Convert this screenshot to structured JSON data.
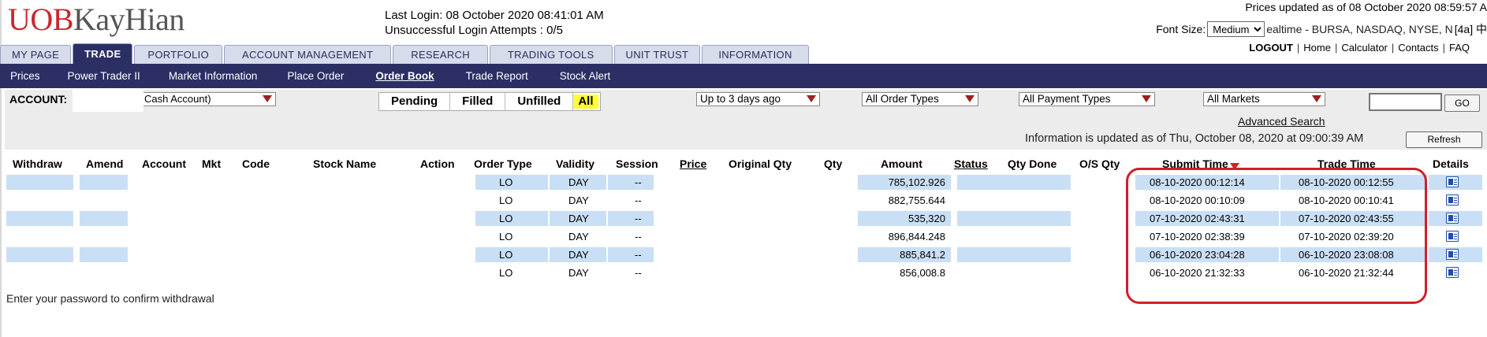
{
  "header": {
    "logo": {
      "part1": "UOB",
      "part2": "KayHian"
    },
    "last_login": "Last Login: 08 October 2020 08:41:01 AM",
    "unsuccessful_attempts": "Unsuccessful Login Attempts : 0/5",
    "prices_updated": "Prices updated as of 08 October 2020 08:59:57 A",
    "font_size_label": "Font Size:",
    "font_size_value": "Medium",
    "realtime_text": "ealtime - BURSA, NASDAQ, NYSE, N",
    "realtime_suffix": "[4a] 中",
    "links": {
      "logout": "LOGOUT",
      "home": "Home",
      "calculator": "Calculator",
      "contacts": "Contacts",
      "faq": "FAQ",
      "sep": "|"
    }
  },
  "tabs": [
    "MY PAGE",
    "TRADE",
    "PORTFOLIO",
    "ACCOUNT MANAGEMENT",
    "RESEARCH",
    "TRADING TOOLS",
    "UNIT TRUST",
    "INFORMATION"
  ],
  "subnav": [
    "Prices",
    "Power Trader II",
    "Market Information",
    "Place Order",
    "Order Book",
    "Trade Report",
    "Stock Alert"
  ],
  "filters": {
    "account_label": "ACCOUNT:",
    "account_value": "Cash Account)",
    "status_tabs": [
      "Pending",
      "Filled",
      "Unfilled",
      "All"
    ],
    "date_range": "Up to 3 days ago",
    "order_types": "All Order Types",
    "payment_types": "All Payment Types",
    "markets": "All Markets",
    "search_value": "",
    "go_label": "GO",
    "advanced_search": "Advanced Search",
    "info_updated": "Information is updated as of Thu, October 08, 2020 at 09:00:39 AM",
    "refresh_label": "Refresh"
  },
  "table": {
    "headers": {
      "withdraw": "Withdraw",
      "amend": "Amend",
      "account": "Account",
      "mkt": "Mkt",
      "code": "Code",
      "stock_name": "Stock Name",
      "action": "Action",
      "order_type": "Order Type",
      "validity": "Validity",
      "session": "Session",
      "price": "Price",
      "original_qty": "Original Qty",
      "qty": "Qty",
      "amount": "Amount",
      "status": "Status",
      "qty_done": "Qty Done",
      "os_qty": "O/S Qty",
      "submit_time": "Submit Time",
      "trade_time": "Trade Time",
      "details": "Details"
    },
    "rows": [
      {
        "order_type": "LO",
        "validity": "DAY",
        "session": "--",
        "amount": "785,102.926",
        "submit_time": "08-10-2020 00:12:14",
        "trade_time": "08-10-2020 00:12:55",
        "icon": "details-icon"
      },
      {
        "order_type": "LO",
        "validity": "DAY",
        "session": "--",
        "amount": "882,755.644",
        "submit_time": "08-10-2020 00:10:09",
        "trade_time": "08-10-2020 00:10:41",
        "icon": "details-icon"
      },
      {
        "order_type": "LO",
        "validity": "DAY",
        "session": "--",
        "amount": "535,320",
        "submit_time": "07-10-2020 02:43:31",
        "trade_time": "07-10-2020 02:43:55",
        "icon": "details-icon"
      },
      {
        "order_type": "LO",
        "validity": "DAY",
        "session": "--",
        "amount": "896,844.248",
        "submit_time": "07-10-2020 02:38:39",
        "trade_time": "07-10-2020 02:39:20",
        "icon": "details-icon"
      },
      {
        "order_type": "LO",
        "validity": "DAY",
        "session": "--",
        "amount": "885,841.2",
        "submit_time": "06-10-2020 23:04:28",
        "trade_time": "06-10-2020 23:08:08",
        "icon": "details-icon"
      },
      {
        "order_type": "LO",
        "validity": "DAY",
        "session": "--",
        "amount": "856,008.8",
        "submit_time": "06-10-2020 21:32:33",
        "trade_time": "06-10-2020 21:32:44",
        "icon": "details-icon"
      }
    ]
  },
  "footer_text": "Enter your password to confirm withdrawal",
  "colors": {
    "nav": "#2c2f64",
    "row_highlight": "#c9dff5",
    "annotation": "#d02028",
    "all_tab": "#ffff33"
  }
}
